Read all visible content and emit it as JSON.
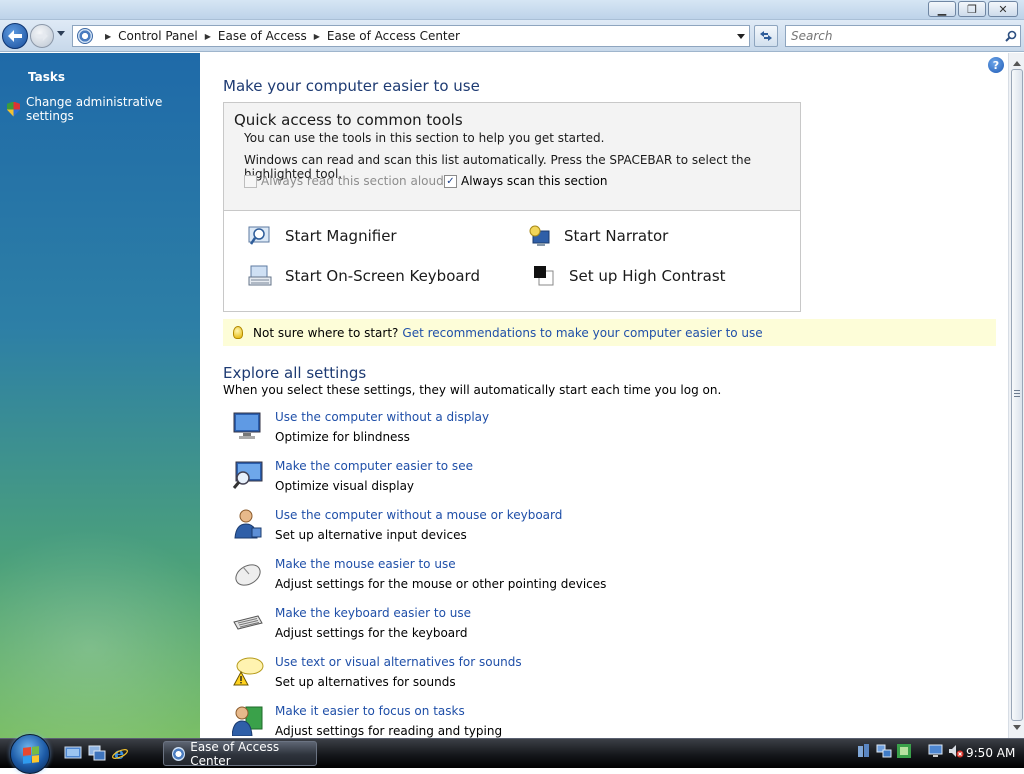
{
  "window": {
    "minimize_glyph": "▁",
    "maximize_glyph": "❐",
    "close_glyph": "✕"
  },
  "navbar": {
    "breadcrumbs": [
      "Control Panel",
      "Ease of Access",
      "Ease of Access Center"
    ],
    "search_placeholder": "Search",
    "icons": [
      "back-arrow-icon",
      "forward-arrow-icon",
      "control-panel-icon",
      "refresh-icon",
      "search-icon"
    ]
  },
  "taskpane": {
    "title": "Tasks",
    "items": [
      {
        "label": "Change administrative settings",
        "icon": "uac-shield-icon"
      }
    ]
  },
  "main": {
    "title": "Make your computer easier to use",
    "quick_access": {
      "title": "Quick access to common tools",
      "line1": "You can use the tools in this section to help you get started.",
      "line2": "Windows can read and scan this list automatically.  Press the SPACEBAR to select the highlighted tool.",
      "read_aloud_label": "Always read this section aloud",
      "read_aloud_checked": false,
      "scan_label": "Always scan this section",
      "scan_checked": true,
      "tools": [
        {
          "label": "Start Magnifier",
          "icon": "magnifier-icon"
        },
        {
          "label": "Start Narrator",
          "icon": "narrator-icon"
        },
        {
          "label": "Start On-Screen Keyboard",
          "icon": "onscreen-keyboard-icon"
        },
        {
          "label": "Set up High Contrast",
          "icon": "high-contrast-icon"
        }
      ]
    },
    "tip": {
      "text": "Not sure where to start?",
      "link": "Get recommendations to make your computer easier to use"
    },
    "explore": {
      "title": "Explore all settings",
      "subtitle": "When you select these settings, they will automatically start each time you log on.",
      "items": [
        {
          "link": "Use the computer without a display",
          "desc": "Optimize for blindness",
          "icon": "monitor-icon"
        },
        {
          "link": "Make the computer easier to see",
          "desc": "Optimize visual display",
          "icon": "magnify-monitor-icon"
        },
        {
          "link": "Use the computer without a mouse or keyboard",
          "desc": "Set up alternative input devices",
          "icon": "user-icon"
        },
        {
          "link": "Make the mouse easier to use",
          "desc": "Adjust settings for the mouse or other pointing devices",
          "icon": "mouse-icon"
        },
        {
          "link": "Make the keyboard easier to use",
          "desc": "Adjust settings for the keyboard",
          "icon": "keyboard-icon"
        },
        {
          "link": "Use text or visual alternatives for sounds",
          "desc": "Set up alternatives for sounds",
          "icon": "speech-bubble-warning-icon"
        },
        {
          "link": "Make it easier to focus on tasks",
          "desc": "Adjust settings for reading and typing",
          "icon": "user-focus-icon"
        }
      ]
    }
  },
  "taskbar": {
    "active_window": "Ease of Access Center",
    "clock": "9:50 AM",
    "quick_launch": [
      "show-desktop-icon",
      "switch-windows-icon",
      "internet-explorer-icon"
    ],
    "tray_icons": [
      "sync-icon",
      "network-icon",
      "accessibility-icon",
      "monitor-tray-icon",
      "volume-muted-icon"
    ]
  },
  "colors": {
    "link": "#1f4fa8",
    "heading": "#1e3b73",
    "tip_background": "#fdfdd8"
  }
}
